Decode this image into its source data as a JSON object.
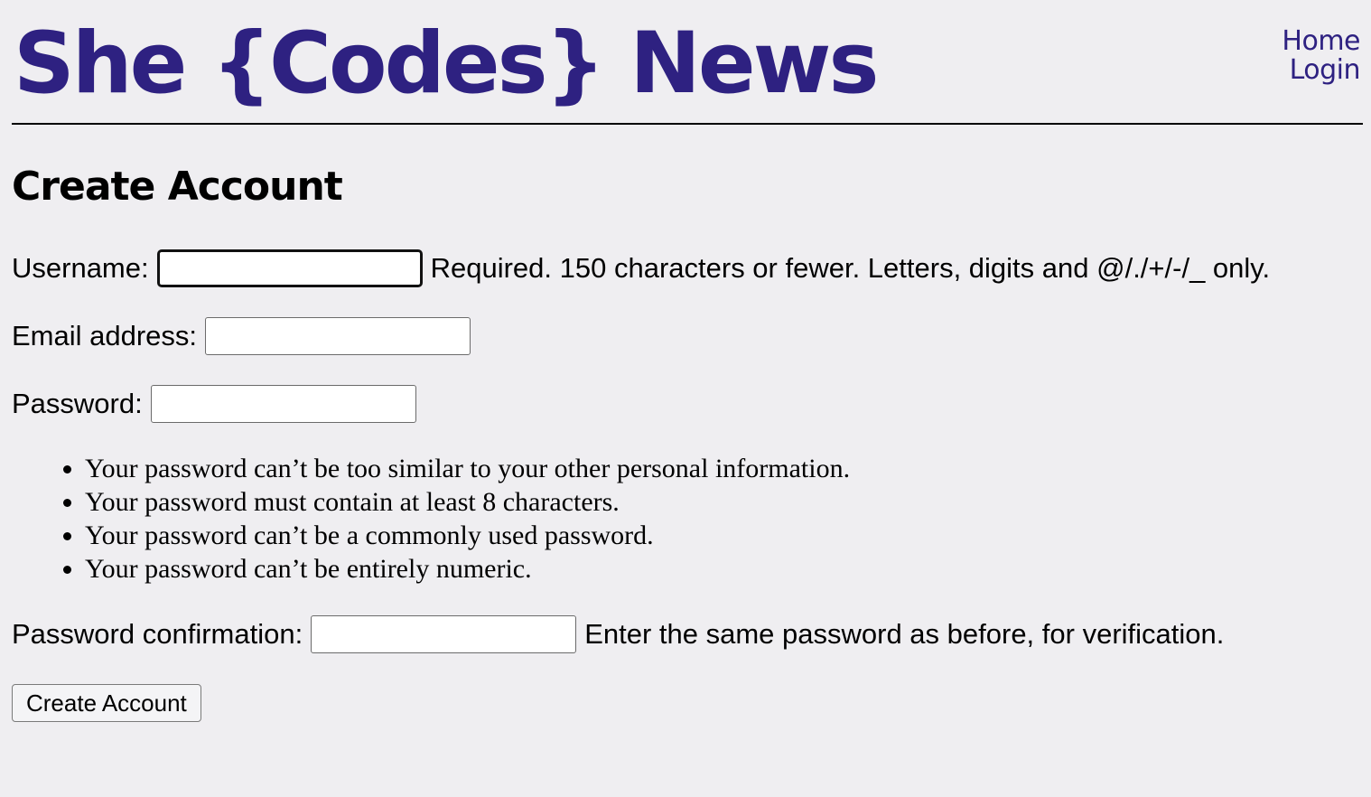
{
  "header": {
    "site_title": "She {Codes} News",
    "brand_color": "#2e2181",
    "nav": {
      "home_label": "Home",
      "login_label": "Login"
    }
  },
  "main": {
    "heading": "Create Account",
    "form": {
      "username": {
        "label": "Username:",
        "value": "",
        "help": "Required. 150 characters or fewer. Letters, digits and @/./+/-/_ only."
      },
      "email": {
        "label": "Email address:",
        "value": ""
      },
      "password": {
        "label": "Password:",
        "value": ""
      },
      "password_rules": [
        "Your password can’t be too similar to your other personal information.",
        "Your password must contain at least 8 characters.",
        "Your password can’t be a commonly used password.",
        "Your password can’t be entirely numeric."
      ],
      "password_confirmation": {
        "label": "Password confirmation:",
        "value": "",
        "help": "Enter the same password as before, for verification."
      },
      "submit_label": "Create Account"
    }
  }
}
